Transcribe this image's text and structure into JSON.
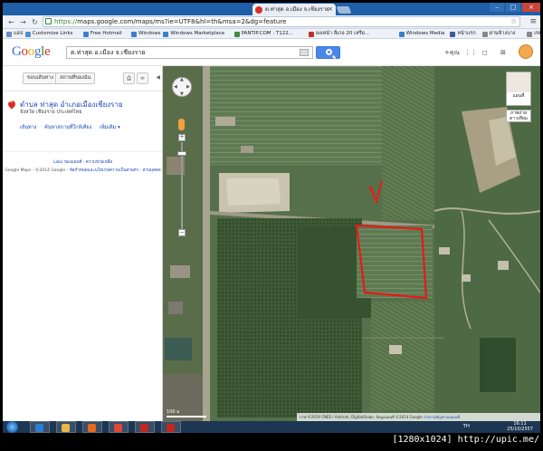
{
  "browser": {
    "tab_title": "ต.ท่าสุด อ.เมือง จ.เชียงราย",
    "url_scheme": "https://",
    "url_rest": "maps.google.com/maps/ms?ie=UTF8&hl=th&msa=2&dg=feature",
    "bookmarks": [
      {
        "label": "แอป",
        "color": "#6a8cc7"
      },
      {
        "label": "Customize Links",
        "color": "#4f8fd8"
      },
      {
        "label": "Free Hotmail",
        "color": "#3a7fd0"
      },
      {
        "label": "Windows",
        "color": "#3a7fd0"
      },
      {
        "label": "Windows Marketplace",
        "color": "#3a7fd0"
      },
      {
        "label": "PANTIP.COM : T122...",
        "color": "#3f8f3a"
      },
      {
        "label": "ลงเหน้า ลีเกอ 20 เหรีย...",
        "color": "#c0302a"
      },
      {
        "label": "Windows Media",
        "color": "#3a7fd0"
      },
      {
        "label": "หน้าแรก",
        "color": "#3b5b99"
      },
      {
        "label": "ผ่านข้างบาง",
        "color": "#888888"
      },
      {
        "label": "เขติ้นใหม่",
        "color": "#888888"
      }
    ]
  },
  "google_header": {
    "logo_letters": [
      {
        "ch": "G",
        "color": "#3b6fd6"
      },
      {
        "ch": "o",
        "color": "#d93025"
      },
      {
        "ch": "o",
        "color": "#f2b400"
      },
      {
        "ch": "g",
        "color": "#3b6fd6"
      },
      {
        "ch": "l",
        "color": "#2f8a3a"
      },
      {
        "ch": "e",
        "color": "#d93025"
      }
    ],
    "search_value": "ต.ท่าสุด อ.เมือง จ.เชียงราย",
    "plus_label": "+คุณ"
  },
  "left_panel": {
    "btn_save": "ขอบเส้นทาง",
    "btn_nearby": "สถานที่ของฉัน",
    "place_title": "ตำบล ท่าสุด อำเภอเมืองเชียงราย",
    "place_subtitle": "จังหวัด เชียงราย ประเทศไทย",
    "actions": [
      "เส้นทาง",
      "ค้นหาสถานที่ใกล้เคียง",
      "เพิ่มเติม ▾"
    ],
    "labs_line": "Labs ของแผนที่ - ความช่วยเหลือ",
    "copyright_prefix": "Google Maps - ©2014 Google - ",
    "copyright_link": "ข้อกำหนดและนโยบายความเป็นส่วนตัว - ส่วนบุคคล"
  },
  "map": {
    "maptype_label": "แผนที่",
    "terrain_label": "ภาพถ่ายดาวเทียม",
    "scale_label": "100 ม",
    "attribution": "ภาพ ©2014 CNES / Astrium, DigitalGlobe, ข้อมูลแผนที่ ©2014 Google",
    "attribution_link": "รายงานปัญหาบนแผนที่"
  },
  "taskbar": {
    "apps": [
      {
        "name": "ie-icon",
        "color": "#2a7fd4"
      },
      {
        "name": "explorer-icon",
        "color": "#e6b84a"
      },
      {
        "name": "firefox-icon",
        "color": "#e46a1e"
      },
      {
        "name": "chrome-icon",
        "color": "#e2453a"
      },
      {
        "name": "flash-icon",
        "color": "#c2261f"
      },
      {
        "name": "app-icon",
        "color": "#c2261f"
      }
    ],
    "lang": "TH",
    "time": "16:11",
    "date": "25/10/2557"
  },
  "watermark": "[1280x1024] http://upic.me/"
}
